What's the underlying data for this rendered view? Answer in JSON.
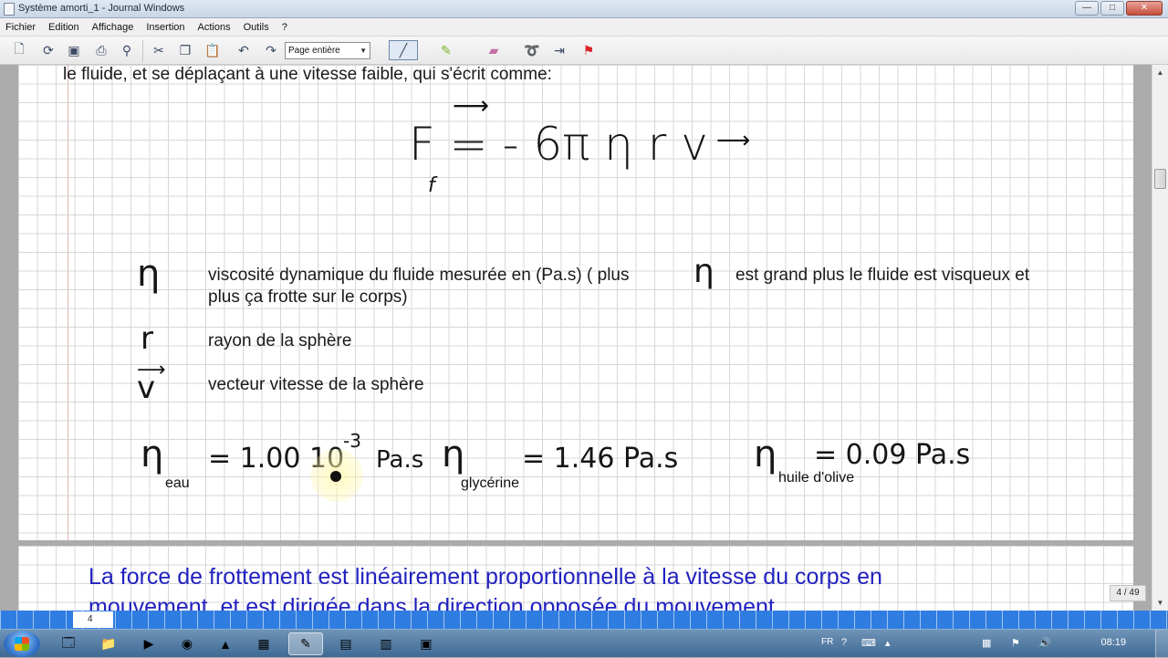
{
  "window": {
    "title": "Système amorti_1 - Journal Windows",
    "minimize": "—",
    "maximize": "□",
    "close": "✕"
  },
  "menu": [
    "Fichier",
    "Edition",
    "Affichage",
    "Insertion",
    "Actions",
    "Outils",
    "?"
  ],
  "toolbar": {
    "zoom_value": "Page entière",
    "icons": [
      "new-page-icon",
      "open-icon",
      "save-icon",
      "print-icon",
      "find-icon",
      "cut-icon",
      "copy-icon",
      "paste-icon",
      "undo-icon",
      "redo-icon",
      "pen-icon",
      "highlighter-icon",
      "eraser-icon",
      "lasso-icon",
      "insert-space-icon",
      "flag-icon"
    ]
  },
  "page1": {
    "intro_line": "le fluide, et se déplaçant à une vitesse faible, qui s'écrit comme:",
    "formula": "F = - 6π η r v",
    "formula_subscript": "f",
    "defs": [
      {
        "symbol": "η",
        "text_line1": "viscosité dynamique du fluide mesurée en (Pa.s)  ( plus",
        "mid_symbol": "η",
        "text_line1b": "est grand plus le fluide est visqueux et",
        "text_line2": "plus ça frotte sur le corps)"
      },
      {
        "symbol": "r",
        "text": "rayon de la sphère"
      },
      {
        "symbol": "v",
        "text": "vecteur vitesse de la sphère"
      }
    ],
    "values": [
      {
        "symbol": "η",
        "subscript": "eau",
        "value": "= 1.00 10",
        "exponent": "-3",
        "unit": "Pa.s"
      },
      {
        "symbol": "η",
        "subscript": "glycérine",
        "value": "= 1.46 Pa.s"
      },
      {
        "symbol": "η",
        "subscript": "huile d'olive",
        "value": "= 0.09 Pa.s"
      }
    ]
  },
  "page2": {
    "line1": "La force de frottement est linéairement proportionnelle à la vitesse du corps en",
    "line2": "mouvement, et est dirigée dans la direction opposée du mouvement."
  },
  "page_counter": "4 / 49",
  "page_tab": "4",
  "tray": {
    "language": "FR",
    "clock": "08:19"
  }
}
